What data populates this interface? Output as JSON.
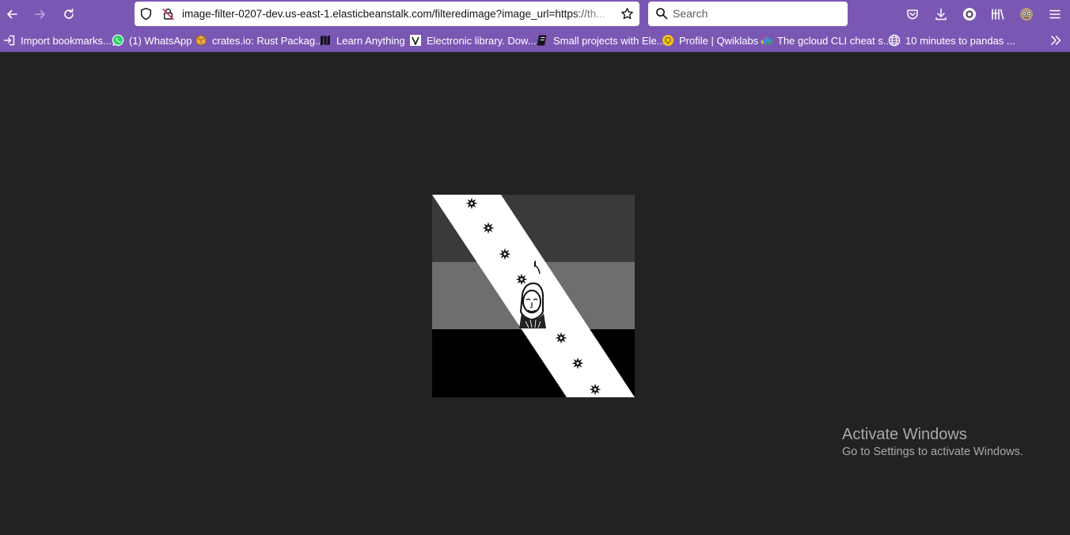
{
  "browser": {
    "address_bar": {
      "url": "image-filter-0207-dev.us-east-1.elasticbeanstalk.com/filteredimage?image_url=https://th..."
    },
    "search_bar": {
      "placeholder": "Search"
    },
    "bookmarks": [
      {
        "label": "Import bookmarks...",
        "icon": "import-icon"
      },
      {
        "label": "(1) WhatsApp",
        "icon": "whatsapp-icon"
      },
      {
        "label": "crates.io: Rust Packag...",
        "icon": "crates-icon"
      },
      {
        "label": "Learn Anything",
        "icon": "map-icon"
      },
      {
        "label": "Electronic library. Dow...",
        "icon": "library-icon"
      },
      {
        "label": "Small projects with Ele...",
        "icon": "notebook-icon"
      },
      {
        "label": "Profile | Qwiklabs",
        "icon": "qwiklabs-icon"
      },
      {
        "label": "The gcloud CLI cheat s...",
        "icon": "gcloud-icon"
      },
      {
        "label": "10 minutes to pandas ...",
        "icon": "globe-icon"
      }
    ]
  },
  "page": {
    "image": {
      "stripe_colors": [
        "#3a3a3a",
        "#6e6e6e",
        "#000000"
      ],
      "band_color": "#ffffff"
    }
  },
  "watermark": {
    "title": "Activate Windows",
    "subtitle": "Go to Settings to activate Windows."
  }
}
